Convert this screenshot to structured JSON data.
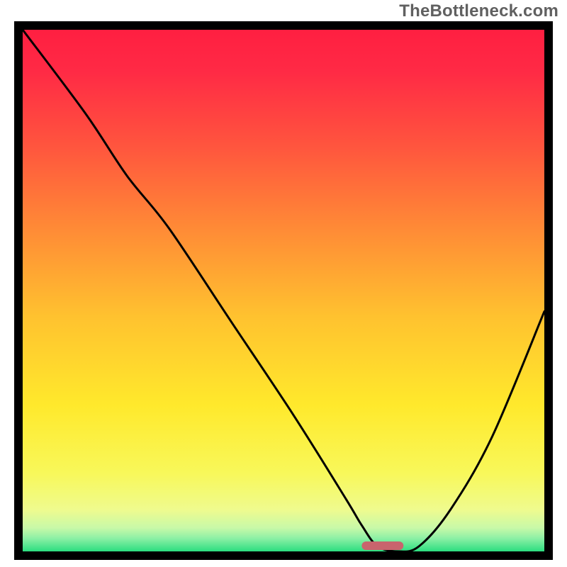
{
  "watermark": "TheBottleneck.com",
  "chart_data": {
    "type": "line",
    "title": "",
    "xlabel": "",
    "ylabel": "",
    "xlim": [
      0,
      100
    ],
    "ylim": [
      0,
      100
    ],
    "grid": false,
    "legend": null,
    "series": [
      {
        "name": "bottleneck-curve",
        "color": "#000000",
        "x": [
          0,
          12,
          20,
          28,
          40,
          52,
          62,
          65,
          68,
          72,
          76,
          82,
          90,
          100
        ],
        "values": [
          100,
          84,
          72,
          62,
          44,
          26,
          10,
          5,
          1,
          0,
          1,
          8,
          22,
          46
        ]
      }
    ],
    "optimal_marker": {
      "x_start": 65,
      "x_end": 73,
      "color": "#C9646D"
    },
    "background_gradient": {
      "stops": [
        {
          "pos": 0.0,
          "color": "#FF1F41"
        },
        {
          "pos": 0.08,
          "color": "#FF2A45"
        },
        {
          "pos": 0.22,
          "color": "#FF543E"
        },
        {
          "pos": 0.38,
          "color": "#FF8A36"
        },
        {
          "pos": 0.55,
          "color": "#FFC22F"
        },
        {
          "pos": 0.72,
          "color": "#FFE92C"
        },
        {
          "pos": 0.85,
          "color": "#F8F85A"
        },
        {
          "pos": 0.92,
          "color": "#EFFB8E"
        },
        {
          "pos": 0.955,
          "color": "#C8F9A8"
        },
        {
          "pos": 0.975,
          "color": "#8CF0A5"
        },
        {
          "pos": 1.0,
          "color": "#2CDE80"
        }
      ]
    }
  }
}
